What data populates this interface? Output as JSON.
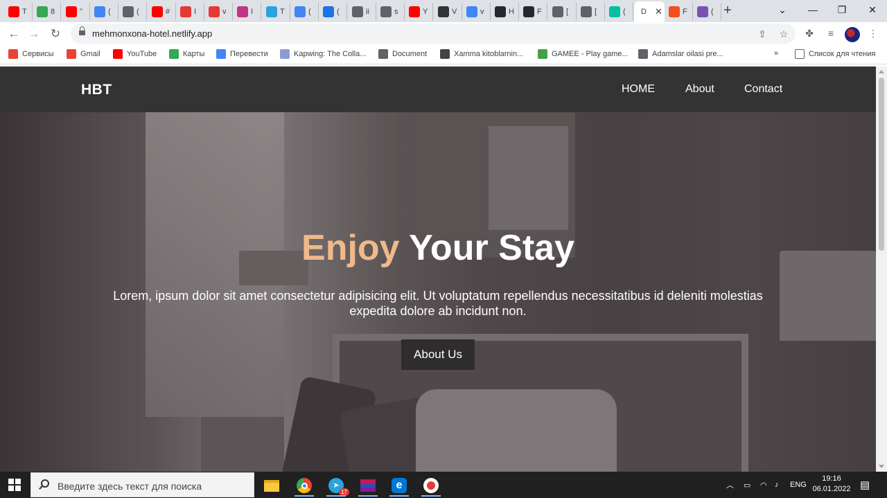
{
  "browser": {
    "tabs": [
      {
        "icon": "youtube-icon",
        "label": "T",
        "color": "#ff0000"
      },
      {
        "icon": "maps-icon",
        "label": "8",
        "color": "#34a853"
      },
      {
        "icon": "youtube-icon",
        "label": "\"",
        "color": "#ff0000"
      },
      {
        "icon": "translate-icon",
        "label": "(",
        "color": "#4285f4"
      },
      {
        "icon": "document-icon",
        "label": "(",
        "color": "#5f6368"
      },
      {
        "icon": "youtube-icon",
        "label": "#",
        "color": "#ff0000"
      },
      {
        "icon": "speed-icon",
        "label": "I",
        "color": "#e53935"
      },
      {
        "icon": "speed-icon",
        "label": "v",
        "color": "#e53935"
      },
      {
        "icon": "instagram-icon",
        "label": "I",
        "color": "#c13584"
      },
      {
        "icon": "telegram-icon",
        "label": "T",
        "color": "#2aa3df"
      },
      {
        "icon": "chat-icon",
        "label": "(",
        "color": "#4285f4"
      },
      {
        "icon": "download-icon",
        "label": "(",
        "color": "#1a73e8"
      },
      {
        "icon": "globe-icon",
        "label": "ii",
        "color": "#5f6368"
      },
      {
        "icon": "globe-icon",
        "label": "s",
        "color": "#5f6368"
      },
      {
        "icon": "youtube-icon",
        "label": "Y",
        "color": "#ff0000"
      },
      {
        "icon": "wikipedia-icon",
        "label": "V",
        "color": "#333333"
      },
      {
        "icon": "google-icon",
        "label": "v",
        "color": "#4285f4"
      },
      {
        "icon": "github-icon",
        "label": "H",
        "color": "#24292e"
      },
      {
        "icon": "github-icon",
        "label": "F",
        "color": "#24292e"
      },
      {
        "icon": "globe-icon",
        "label": "[",
        "color": "#5f6368"
      },
      {
        "icon": "globe-icon",
        "label": "[",
        "color": "#5f6368"
      },
      {
        "icon": "diamond-icon",
        "label": "(",
        "color": "#00bfa5"
      }
    ],
    "active_tab": {
      "label": "D",
      "close": "✕"
    },
    "after_tabs": [
      {
        "icon": "figma-icon",
        "label": "F",
        "color": "#f24e1e"
      },
      {
        "icon": "bootstrap-icon",
        "label": "(",
        "color": "#7952b3"
      }
    ],
    "new_tab": "+",
    "window_controls": {
      "menu": "⌄",
      "minimize": "—",
      "restore": "❐",
      "close": "✕"
    },
    "url": "mehmonxona-hotel.netlify.app",
    "bookmarks": [
      {
        "label": "Сервисы",
        "icon": "apps-grid-icon",
        "color": "#ea4335"
      },
      {
        "label": "Gmail",
        "icon": "gmail-icon",
        "color": "#ea4335"
      },
      {
        "label": "YouTube",
        "icon": "youtube-icon",
        "color": "#ff0000"
      },
      {
        "label": "Карты",
        "icon": "maps-icon",
        "color": "#34a853"
      },
      {
        "label": "Перевести",
        "icon": "translate-icon",
        "color": "#4285f4"
      },
      {
        "label": "Kapwing: The Colla...",
        "icon": "kapwing-icon",
        "color": "#8e9bd4"
      },
      {
        "label": "Document",
        "icon": "globe-icon",
        "color": "#5f6368"
      },
      {
        "label": "Xamma kitoblarnin...",
        "icon": "books-icon",
        "color": "#444444"
      },
      {
        "label": "GAMEE - Play game...",
        "icon": "gamee-icon",
        "color": "#43a047"
      },
      {
        "label": "Adamslar oilasi pre...",
        "icon": "globe-icon",
        "color": "#5f6368"
      }
    ],
    "bookmarks_more": "»",
    "reading_list": "Список для чтения"
  },
  "site": {
    "logo": "HBT",
    "nav": [
      "HOME",
      "About",
      "Contact"
    ],
    "hero": {
      "title_accent": "Enjoy",
      "title_rest": "Your Stay",
      "text": "Lorem, ipsum dolor sit amet consectetur adipisicing elit. Ut voluptatum repellendus necessitatibus id deleniti molestias expedita dolore ab incidunt non.",
      "button": "About Us"
    },
    "colors": {
      "nav_bg": "#333333",
      "accent": "#f0b98a",
      "button_bg": "#2f2c2d"
    }
  },
  "taskbar": {
    "search_placeholder": "Введите здесь текст для поиска",
    "apps": [
      "file-explorer-icon",
      "chrome-icon",
      "telegram-icon",
      "winrar-icon",
      "edge-legacy-icon",
      "recorder-icon"
    ],
    "telegram_badge": "17",
    "language": "ENG",
    "time": "19:16",
    "date": "06.01.2022"
  }
}
